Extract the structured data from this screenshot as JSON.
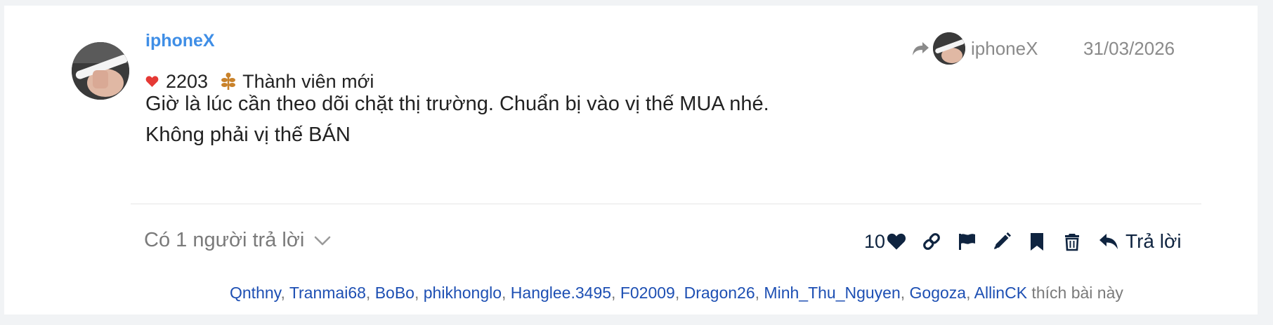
{
  "post": {
    "username": "iphoneX",
    "reactions_score": "2203",
    "user_title": "Thành viên mới",
    "reply_to_username": "iphoneX",
    "date": "31/03/2026",
    "body_lines": [
      "Giờ là lúc cần theo dõi chặt thị trường. Chuẩn bị vào vị thế MUA nhé.",
      "Không phải vị thế BÁN"
    ]
  },
  "footer": {
    "replies_label": "Có 1 người trả lời",
    "like_count": "10",
    "reply_button_label": "Trả lời",
    "likers": [
      "Qnthny",
      "Tranmai68",
      "BoBo",
      "phikhonglo",
      "Hanglee.3495",
      "F02009",
      "Dragon26",
      "Minh_Thu_Nguyen",
      "Gogoza",
      "AllinCK"
    ],
    "likers_separator": ", ",
    "likers_suffix": " thích bài này"
  },
  "icons": {
    "heart": "heart-icon",
    "badge": "seedling-badge-icon",
    "share": "share-arrow-icon",
    "chevron": "chevron-down-icon",
    "link": "link-icon",
    "flag": "flag-icon",
    "edit": "pencil-icon",
    "bookmark": "bookmark-icon",
    "delete": "trash-icon",
    "reply": "reply-arrow-icon"
  },
  "colors": {
    "username": "#3f8ee6",
    "heart": "#e53935",
    "badge": "#c9822a",
    "action_icons": "#0f2440",
    "liker_links": "#1d4fb3",
    "muted_text": "#8a8a8a"
  }
}
